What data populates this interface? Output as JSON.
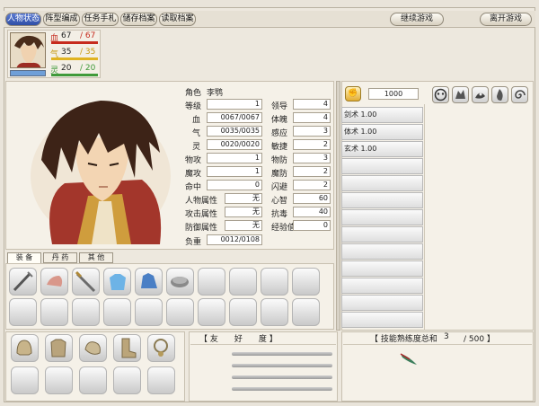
{
  "menu": {
    "tabs": [
      "人物状态",
      "阵型编成",
      "任务手札",
      "储存档案",
      "读取档案"
    ],
    "continue_label": "继续游戏",
    "leave_label": "离开游戏"
  },
  "vitals": {
    "hp_icon": "血",
    "hp_current": "67",
    "hp_max": "/ 67",
    "mp_icon": "气",
    "mp_current": "35",
    "mp_max": "/ 35",
    "sp_icon": "灵",
    "sp_current": "20",
    "sp_max": "/ 20"
  },
  "character": {
    "role_label": "角色",
    "name": "李鹗"
  },
  "stats_left": [
    {
      "label": "等级",
      "value": "1"
    },
    {
      "label": "血",
      "value": "0067/0067"
    },
    {
      "label": "气",
      "value": "0035/0035"
    },
    {
      "label": "灵",
      "value": "0020/0020"
    },
    {
      "label": "物攻",
      "value": "1"
    },
    {
      "label": "魔攻",
      "value": "1"
    },
    {
      "label": "命中",
      "value": "0"
    },
    {
      "label": "人物属性",
      "value": "无"
    },
    {
      "label": "攻击属性",
      "value": "无"
    },
    {
      "label": "防御属性",
      "value": "无"
    },
    {
      "label": "负重",
      "value": "0012/0108"
    }
  ],
  "stats_right": [
    {
      "label": "领导",
      "value": "4"
    },
    {
      "label": "体魄",
      "value": "4"
    },
    {
      "label": "感应",
      "value": "3"
    },
    {
      "label": "敏捷",
      "value": "2"
    },
    {
      "label": "物防",
      "value": "3"
    },
    {
      "label": "魔防",
      "value": "2"
    },
    {
      "label": "闪避",
      "value": "2"
    },
    {
      "label": "心智",
      "value": "60"
    },
    {
      "label": "抗毒",
      "value": "40"
    },
    {
      "label": "经验值",
      "value": "0"
    }
  ],
  "gold": "1000",
  "skills": [
    "剑术 1.00",
    "体术 1.00",
    "玄术 1.00"
  ],
  "equip_tabs": [
    "装 备",
    "丹 药",
    "其 他"
  ],
  "friendship_title": "【 友　　好　　度 】",
  "skill_total": {
    "label": "【 技能熟练度总和",
    "value": "3",
    "max": "/ 500 】"
  },
  "colors": {
    "accent": "#3a58b0",
    "hp": "#c62b1e",
    "mp": "#e0b322",
    "sp": "#3f9a3a"
  }
}
